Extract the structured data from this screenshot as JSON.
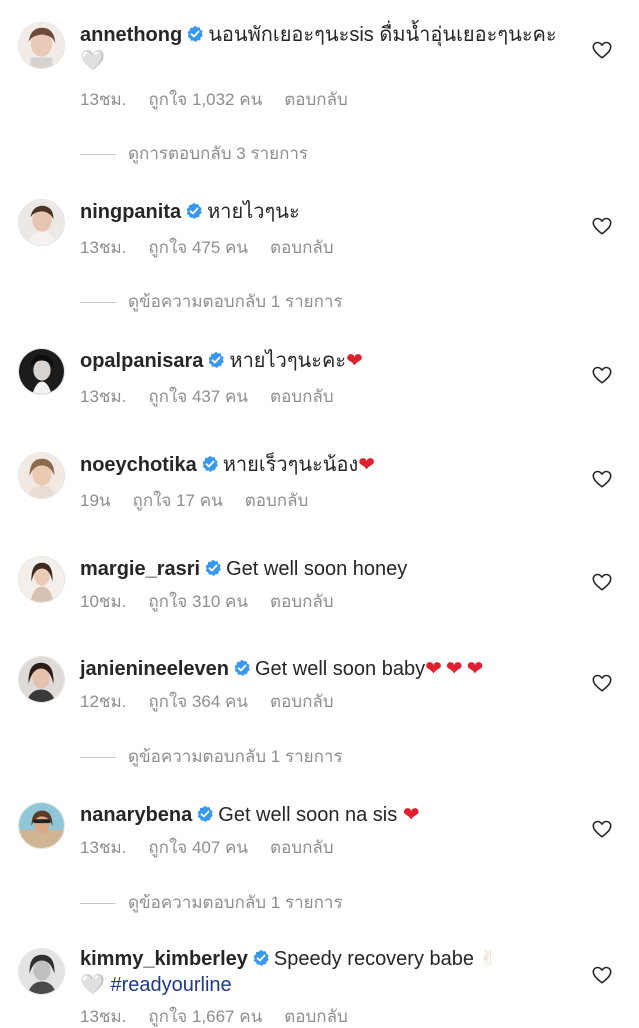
{
  "comments": [
    {
      "username": "annethong",
      "text": "นอนพักเยอะๆนะsis ดื่มน้ำอุ่นเยอะๆนะคะ",
      "emoji": "🤍",
      "time": "13ชม.",
      "likes": "ถูกใจ 1,032 คน",
      "reply_label": "ตอบกลับ",
      "view_replies": "ดูการตอบกลับ 3 รายการ",
      "avatar_icon": "avatar-photo-annethong"
    },
    {
      "username": "ningpanita",
      "text": "หายไวๆนะ",
      "time": "13ชม.",
      "likes": "ถูกใจ 475 คน",
      "reply_label": "ตอบกลับ",
      "view_replies": "ดูข้อความตอบกลับ 1 รายการ",
      "avatar_icon": "avatar-photo-ningpanita"
    },
    {
      "username": "opalpanisara",
      "text": "หายไวๆนะคะ",
      "emoji": "❤",
      "time": "13ชม.",
      "likes": "ถูกใจ 437 คน",
      "reply_label": "ตอบกลับ",
      "avatar_icon": "avatar-photo-opalpanisara"
    },
    {
      "username": "noeychotika",
      "text": "หายเร็วๆนะน้อง",
      "emoji": "❤",
      "time": "19น",
      "likes": "ถูกใจ 17 คน",
      "reply_label": "ตอบกลับ",
      "avatar_icon": "avatar-photo-noeychotika"
    },
    {
      "username": "margie_rasri",
      "text": "Get well soon honey",
      "time": "10ชม.",
      "likes": "ถูกใจ 310 คน",
      "reply_label": "ตอบกลับ",
      "avatar_icon": "avatar-photo-margie"
    },
    {
      "username": "janienineeleven",
      "text": "Get well soon baby",
      "emoji": "❤❤❤",
      "time": "12ชม.",
      "likes": "ถูกใจ 364 คน",
      "reply_label": "ตอบกลับ",
      "view_replies": "ดูข้อความตอบกลับ 1 รายการ",
      "avatar_icon": "avatar-photo-janie"
    },
    {
      "username": "nanarybena",
      "text": "Get well soon na sis",
      "emoji": "❤",
      "time": "13ชม.",
      "likes": "ถูกใจ 407 คน",
      "reply_label": "ตอบกลับ",
      "view_replies": "ดูข้อความตอบกลับ 1 รายการ",
      "avatar_icon": "avatar-photo-nanarybena"
    },
    {
      "username": "kimmy_kimberley",
      "text": "Speedy recovery babe",
      "emoji": "✌",
      "emoji2": "🤍",
      "hashtag": "#readyourline",
      "time": "13ชม.",
      "likes": "ถูกใจ 1,667 คน",
      "reply_label": "ตอบกลับ",
      "avatar_icon": "avatar-photo-kimmy"
    }
  ],
  "icons": {
    "verified": "verified-badge-icon",
    "like": "heart-outline-icon"
  },
  "colors": {
    "verified_blue": "#3897f0",
    "text_primary": "#262626",
    "text_secondary": "#8e8e8e",
    "heart_red": "#e0202e",
    "hashtag_blue": "#1e3a8a"
  }
}
